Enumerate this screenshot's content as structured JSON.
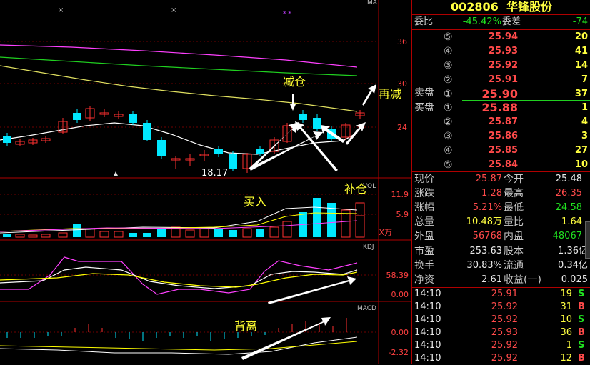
{
  "stock": {
    "code": "002806",
    "name": "华锋股份"
  },
  "price_axis": [
    "36",
    "30",
    "24"
  ],
  "vol_axis": [
    "11.9",
    "5.9"
  ],
  "vol_unit": "X万",
  "kdj_axis": [
    "58.39",
    "0.00"
  ],
  "macd_axis": [
    "0.00",
    "-2.32"
  ],
  "chart_labels": {
    "ma": "MA",
    "vol": "VOL",
    "kdj": "KDJ",
    "macd": "MACD",
    "low_label": "18.17"
  },
  "annotations": {
    "buy": "买入",
    "reduce": "减仓",
    "reduce_again": "再减",
    "add": "补仓",
    "divergence": "背离"
  },
  "commission": {
    "ratio_label": "委比",
    "ratio": "-45.42%",
    "diff_label": "委差",
    "diff": "-74"
  },
  "sell_label": "卖盘",
  "buy_label": "买盘",
  "asks": [
    {
      "level": "⑤",
      "price": "25.94",
      "vol": "20"
    },
    {
      "level": "④",
      "price": "25.93",
      "vol": "41"
    },
    {
      "level": "③",
      "price": "25.92",
      "vol": "14"
    },
    {
      "level": "②",
      "price": "25.91",
      "vol": "7"
    },
    {
      "level": "①",
      "price": "25.90",
      "vol": "37"
    }
  ],
  "bids": [
    {
      "level": "①",
      "price": "25.88",
      "vol": "1"
    },
    {
      "level": "②",
      "price": "25.87",
      "vol": "4"
    },
    {
      "level": "③",
      "price": "25.86",
      "vol": "3"
    },
    {
      "level": "④",
      "price": "25.85",
      "vol": "27"
    },
    {
      "level": "⑤",
      "price": "25.84",
      "vol": "10"
    }
  ],
  "quote": [
    {
      "l1": "现价",
      "v1": "25.87",
      "l2": "今开",
      "v2": "25.48"
    },
    {
      "l1": "涨跌",
      "v1": "1.28",
      "l2": "最高",
      "v2": "26.35"
    },
    {
      "l1": "涨幅",
      "v1": "5.21%",
      "l2": "最低",
      "v2": "24.58"
    },
    {
      "l1": "总量",
      "v1": "10.48万",
      "l2": "量比",
      "v2": "1.64"
    },
    {
      "l1": "外盘",
      "v1": "56768",
      "l2": "内盘",
      "v2": "48067"
    }
  ],
  "fundamentals": [
    {
      "l1": "市盈",
      "v1": "253.63",
      "l2": "股本",
      "v2": "1.36亿"
    },
    {
      "l1": "换手",
      "v1": "30.83%",
      "l2": "流通",
      "v2": "0.34亿"
    },
    {
      "l1": "净资",
      "v1": "2.61",
      "l2": "收益(一)",
      "v2": "0.025"
    }
  ],
  "ticks": [
    {
      "time": "14:10",
      "price": "25.91",
      "vol": "19",
      "side": "S"
    },
    {
      "time": "14:10",
      "price": "25.92",
      "vol": "31",
      "side": "B"
    },
    {
      "time": "14:10",
      "price": "25.92",
      "vol": "10",
      "side": "S"
    },
    {
      "time": "14:10",
      "price": "25.93",
      "vol": "36",
      "side": "B"
    },
    {
      "time": "14:10",
      "price": "25.92",
      "vol": "1",
      "side": "S"
    },
    {
      "time": "14:10",
      "price": "25.92",
      "vol": "12",
      "side": "B"
    }
  ],
  "colors": {
    "up": "#ff3030",
    "down": "#00e8ff",
    "grid": "#b00000",
    "ma5": "#ffffff",
    "ma10": "#ffff00",
    "ma20": "#ff00ff",
    "ma60": "#00ff00"
  }
}
